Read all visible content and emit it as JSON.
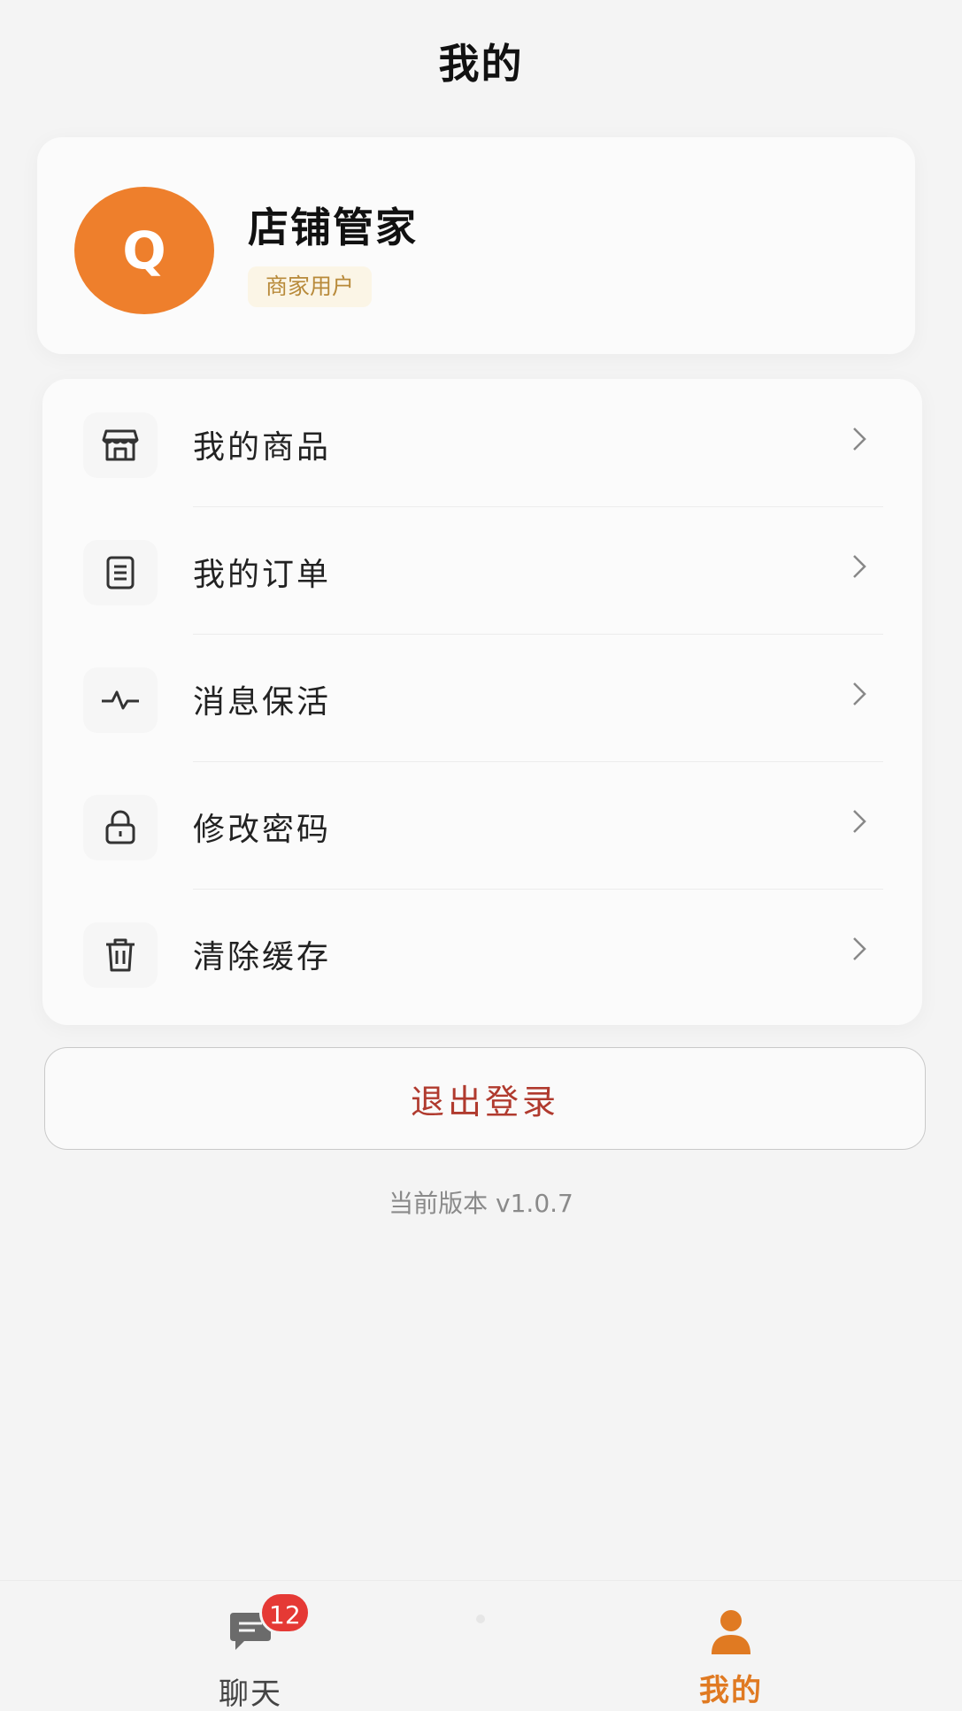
{
  "header": {
    "title": "我的"
  },
  "profile": {
    "avatar_letter": "Q",
    "name": "店铺管家",
    "role": "商家用户"
  },
  "menu": {
    "items": [
      {
        "label": "我的商品",
        "icon": "storefront-icon"
      },
      {
        "label": "我的订单",
        "icon": "document-icon"
      },
      {
        "label": "消息保活",
        "icon": "pulse-icon"
      },
      {
        "label": "修改密码",
        "icon": "lock-icon"
      },
      {
        "label": "清除缓存",
        "icon": "trash-icon"
      }
    ]
  },
  "logout_label": "退出登录",
  "version_text": "当前版本 v1.0.7",
  "tabbar": {
    "chat": {
      "label": "聊天",
      "badge": "12",
      "icon": "chat-icon"
    },
    "mine": {
      "label": "我的",
      "icon": "person-icon",
      "active": true
    }
  },
  "colors": {
    "accent": "#ee7f2c",
    "logout_text": "#b03a2e",
    "badge": "#e53935",
    "role_badge_bg": "#fbf5e6",
    "role_badge_text": "#b88a3a"
  }
}
